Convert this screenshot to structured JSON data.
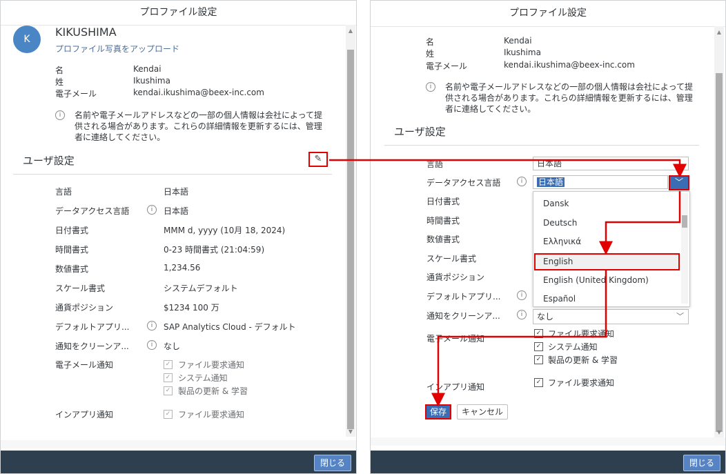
{
  "dialog_title": "プロファイル設定",
  "close_label": "閉じる",
  "left": {
    "avatar_initial": "K",
    "username": "KIKUSHIMA",
    "upload_link": "プロファイル写真をアップロード",
    "profile": [
      {
        "label": "名",
        "value": "Kendai"
      },
      {
        "label": "姓",
        "value": "Ikushima"
      },
      {
        "label": "電子メール",
        "value": "kendai.ikushima@beex-inc.com"
      }
    ],
    "info_note": "名前や電子メールアドレスなどの一部の個人情報は会社によって提供される場合があります。これらの詳細情報を更新するには、管理者に連絡してください。",
    "user_settings_title": "ユーザ設定",
    "settings": [
      {
        "label": "言語",
        "value": "日本語"
      },
      {
        "label": "データアクセス言語",
        "value": "日本語"
      },
      {
        "label": "日付書式",
        "value": "MMM d, yyyy (10月 18, 2024)"
      },
      {
        "label": "時間書式",
        "value": "0-23 時間書式 (21:04:59)"
      },
      {
        "label": "数値書式",
        "value": "1,234.56"
      },
      {
        "label": "スケール書式",
        "value": "システムデフォルト"
      },
      {
        "label": "通貨ポジション",
        "value": "$1234 100 万"
      },
      {
        "label": "デフォルトアプリ...",
        "value": "SAP Analytics Cloud - デフォルト"
      },
      {
        "label": "通知をクリーンア...",
        "value": "なし"
      }
    ],
    "email_notify_label": "電子メール通知",
    "email_options": [
      "ファイル要求通知",
      "システム通知",
      "製品の更新 & 学習"
    ],
    "inapp_label": "インアプリ通知",
    "inapp_options": [
      "ファイル要求通知"
    ]
  },
  "right": {
    "profile": [
      {
        "label": "名",
        "value": "Kendai"
      },
      {
        "label": "姓",
        "value": "Ikushima"
      },
      {
        "label": "電子メール",
        "value": "kendai.ikushima@beex-inc.com"
      }
    ],
    "info_note": "名前や電子メールアドレスなどの一部の個人情報は会社によって提供される場合があります。これらの詳細情報を更新するには、管理者に連絡してください。",
    "user_settings_title": "ユーザ設定",
    "labels": [
      "言語",
      "データアクセス言語",
      "日付書式",
      "時間書式",
      "数値書式",
      "スケール書式",
      "通貨ポジション",
      "デフォルトアプリ...",
      "通知をクリーンア..."
    ],
    "language_value": "日本語",
    "data_access_value": "日本語",
    "dropdown_options": [
      "Dansk",
      "Deutsch",
      "Ελληνικά",
      "English",
      "English (United Kingdom)",
      "Español"
    ],
    "highlighted_option": "English",
    "cleanup_value": "なし",
    "email_notify_label": "電子メール通知",
    "email_options": [
      "ファイル要求通知",
      "システム通知",
      "製品の更新 & 学習"
    ],
    "inapp_label": "インアプリ通知",
    "inapp_options": [
      "ファイル要求通知"
    ],
    "save_label": "保存",
    "cancel_label": "キャンセル"
  },
  "colors": {
    "accent": "#3b6db4",
    "annotation": "#e00000",
    "footer": "#2e3f50"
  }
}
